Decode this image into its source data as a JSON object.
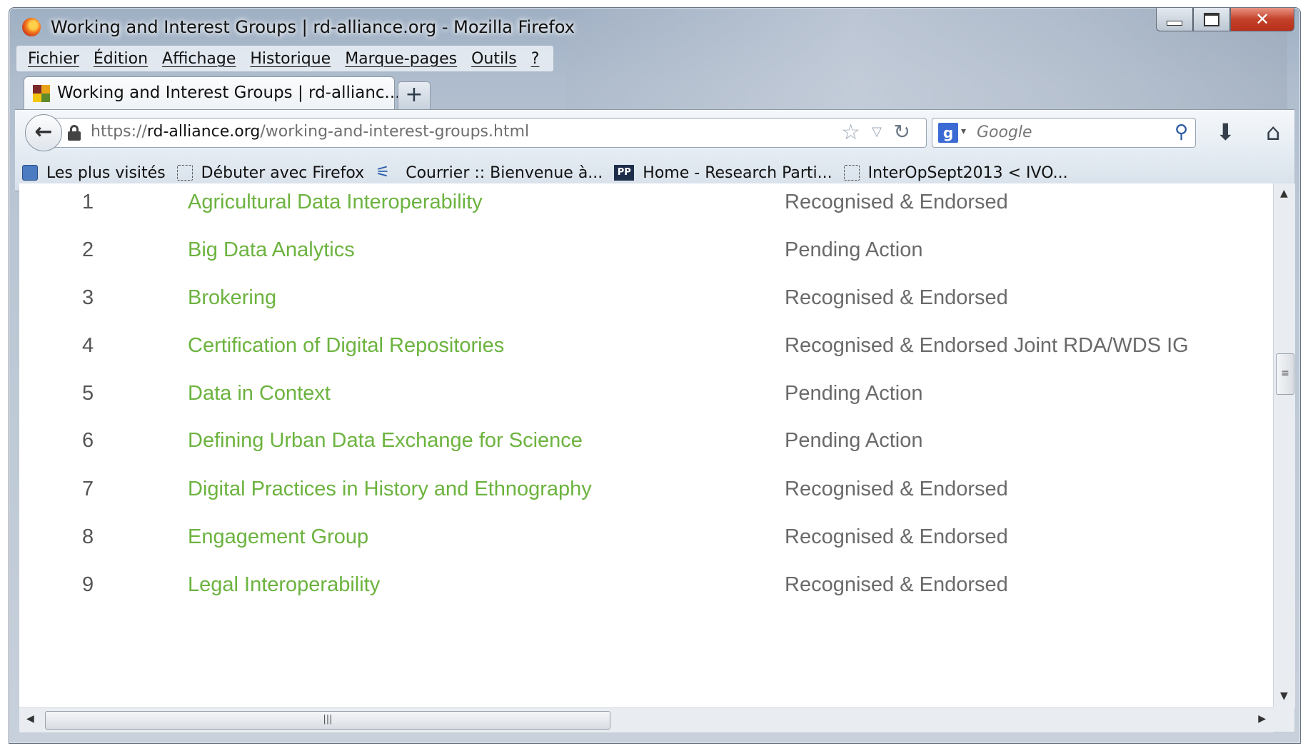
{
  "window": {
    "title": "Working and Interest Groups | rd-alliance.org - Mozilla Firefox"
  },
  "window_controls": {
    "minimize": "–",
    "maximize": "□",
    "close": "✕"
  },
  "menubar": {
    "items": [
      "Fichier",
      "Édition",
      "Affichage",
      "Historique",
      "Marque-pages",
      "Outils",
      "?"
    ]
  },
  "tab": {
    "label": "Working and Interest Groups | rd-allianc...",
    "new_tab": "+"
  },
  "navbar": {
    "url_prefix": "https://",
    "url_domain": "rd-alliance.org",
    "url_path": "/working-and-interest-groups.html",
    "search_placeholder": "Google",
    "icons": [
      "back-icon",
      "lock-icon",
      "star-icon",
      "reload-icon",
      "google-icon",
      "search-icon",
      "download-icon",
      "home-icon"
    ]
  },
  "bookmarks": [
    {
      "label": "Les plus visités",
      "icon": "most-visited-icon"
    },
    {
      "label": "Débuter avec Firefox",
      "icon": "page-icon"
    },
    {
      "label": "Courrier :: Bienvenue à...",
      "icon": "mail-icon"
    },
    {
      "label": "Home - Research Parti...",
      "icon": "pp-icon"
    },
    {
      "label": "InterOpSept2013 < IVO...",
      "icon": "page-icon"
    }
  ],
  "groups": [
    {
      "num": "1",
      "name": "Agricultural Data Interoperability",
      "status": "Recognised & Endorsed"
    },
    {
      "num": "2",
      "name": "Big Data Analytics",
      "status": "Pending Action"
    },
    {
      "num": "3",
      "name": "Brokering",
      "status": "Recognised & Endorsed"
    },
    {
      "num": "4",
      "name": "Certification of Digital Repositories",
      "status": "Recognised & Endorsed Joint RDA/WDS IG"
    },
    {
      "num": "5",
      "name": "Data in Context",
      "status": "Pending Action"
    },
    {
      "num": "6",
      "name": "Defining Urban Data Exchange for Science",
      "status": "Pending Action"
    },
    {
      "num": "7",
      "name": "Digital Practices in History and Ethnography",
      "status": "Recognised & Endorsed"
    },
    {
      "num": "8",
      "name": "Engagement Group",
      "status": "Recognised & Endorsed"
    },
    {
      "num": "9",
      "name": "Legal Interoperability",
      "status": "Recognised & Endorsed"
    }
  ],
  "colors": {
    "link": "#6cb33f",
    "status_text": "#6a6a6a",
    "number_text": "#555555"
  }
}
